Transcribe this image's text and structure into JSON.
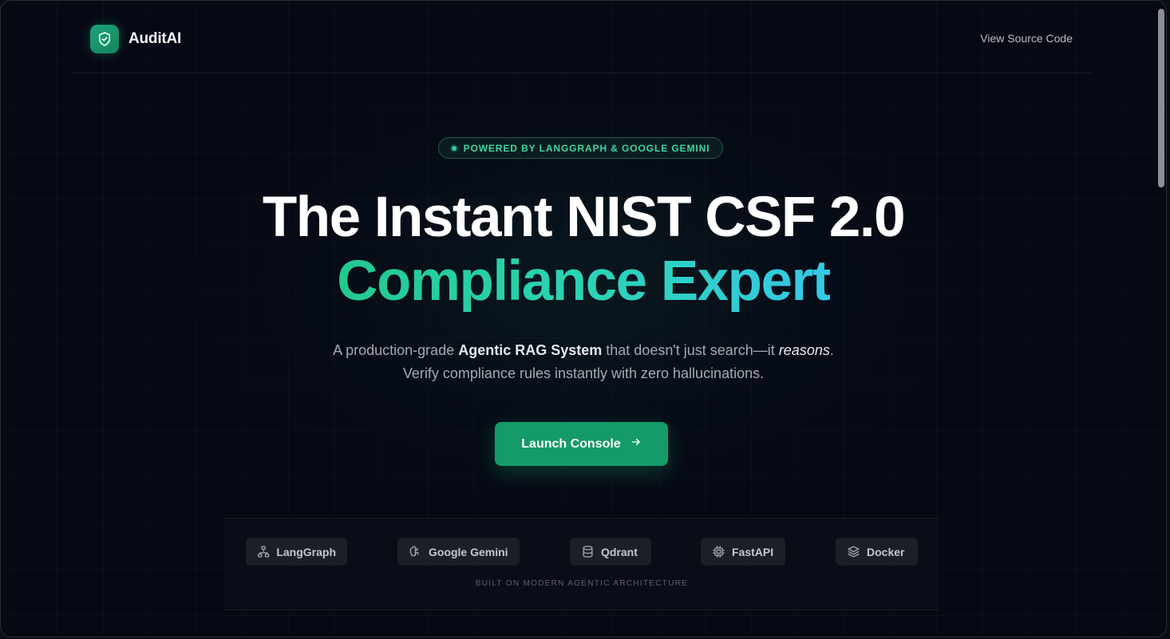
{
  "nav": {
    "brand": "AuditAI",
    "source_link": "View Source Code"
  },
  "badge": {
    "text": "POWERED BY LANGGRAPH & GOOGLE GEMINI"
  },
  "hero": {
    "line1": "The Instant NIST CSF 2.0",
    "line2": "Compliance Expert"
  },
  "subtitle": {
    "part1": "A production-grade ",
    "bold": "Agentic RAG System",
    "part2": " that doesn't just search—it ",
    "italic": "reasons",
    "part3": ".",
    "line2": "Verify compliance rules instantly with zero hallucinations."
  },
  "cta": {
    "label": "Launch Console"
  },
  "tech_stack": {
    "items": [
      {
        "label": "LangGraph",
        "icon": "network-icon"
      },
      {
        "label": "Google Gemini",
        "icon": "brain-icon"
      },
      {
        "label": "Qdrant",
        "icon": "database-icon"
      },
      {
        "label": "FastAPI",
        "icon": "cpu-icon"
      },
      {
        "label": "Docker",
        "icon": "layers-icon"
      }
    ],
    "caption": "BUILT ON MODERN AGENTIC ARCHITECTURE"
  },
  "colors": {
    "accent": "#159b68",
    "gradient_start": "#22c98e",
    "gradient_end": "#35c9e6",
    "background": "#060914"
  }
}
